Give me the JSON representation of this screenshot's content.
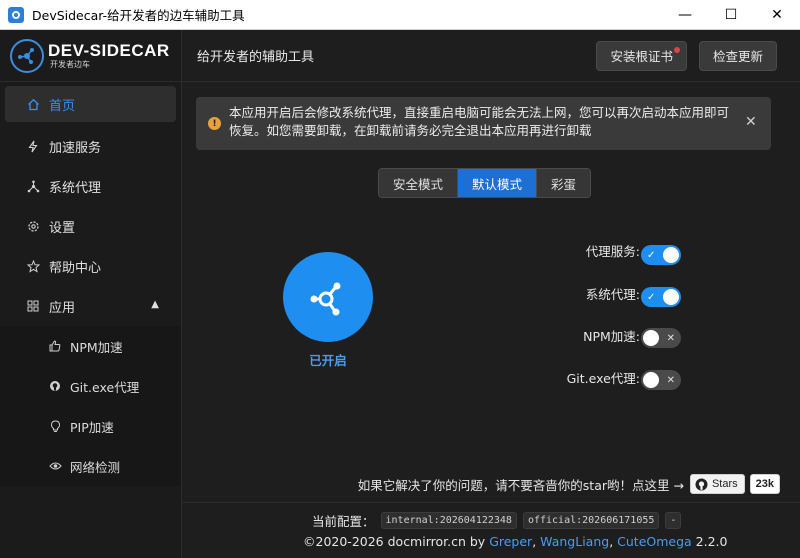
{
  "window": {
    "title": "DevSidecar-给开发者的边车辅助工具",
    "minimize": "—",
    "maximize": "☐",
    "close": "✕"
  },
  "logo": {
    "main": "DEV-SIDECAR",
    "sub": "开发者边车"
  },
  "sidebar": {
    "items": [
      {
        "label": "首页",
        "icon": "home-icon"
      },
      {
        "label": "加速服务",
        "icon": "lightning-icon"
      },
      {
        "label": "系统代理",
        "icon": "network-icon"
      },
      {
        "label": "设置",
        "icon": "gear-icon"
      },
      {
        "label": "帮助中心",
        "icon": "star-icon"
      },
      {
        "label": "应用",
        "icon": "apps-icon"
      }
    ],
    "sub_items": [
      {
        "label": "NPM加速",
        "icon": "thumb-icon"
      },
      {
        "label": "Git.exe代理",
        "icon": "github-icon"
      },
      {
        "label": "PIP加速",
        "icon": "bulb-icon"
      },
      {
        "label": "网络检测",
        "icon": "eye-icon"
      }
    ]
  },
  "header": {
    "title": "给开发者的辅助工具",
    "install_cert": "安装根证书",
    "check_update": "检查更新"
  },
  "alert": {
    "text": "本应用开启后会修改系统代理，直接重启电脑可能会无法上网，您可以再次启动本应用即可恢复。如您需要卸载，在卸载前请务必完全退出本应用再进行卸载"
  },
  "modes": [
    "安全模式",
    "默认模式",
    "彩蛋"
  ],
  "power": {
    "status": "已开启"
  },
  "switches": [
    {
      "label": "代理服务:",
      "on": true
    },
    {
      "label": "系统代理:",
      "on": true
    },
    {
      "label": "NPM加速:",
      "on": false
    },
    {
      "label": "Git.exe代理:",
      "on": false
    }
  ],
  "footer": {
    "star_prompt": "如果它解决了你的问题，请不要吝啬你的star哟！点这里 →",
    "stars_label": "Stars",
    "stars_count": "23k",
    "config_label": "当前配置：",
    "config_internal": "internal:202604122348",
    "config_official": "official:202606171055",
    "config_extra": "-",
    "copyright": "©2020-2026 docmirror.cn by ",
    "author1": "Greper",
    "author2": "WangLiang",
    "author3": "CuteOmega",
    "sep": ", ",
    "version": "2.2.0"
  },
  "colors": {
    "accent": "#1f8ef1",
    "mode_selected": "#1d6fd4",
    "warning": "#e6a23c"
  }
}
